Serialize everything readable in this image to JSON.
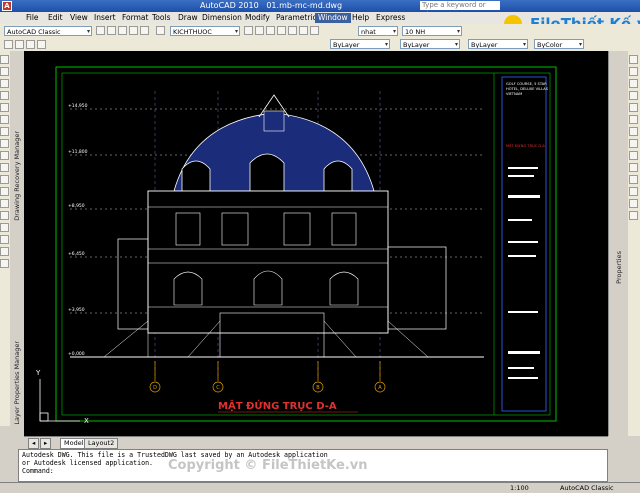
{
  "titlebar": {
    "app_title": "AutoCAD 2010",
    "file_name": "01.mb-mc-md.dwg",
    "search_placeholder": "Type a keyword or phrase"
  },
  "menu": [
    "File",
    "Edit",
    "View",
    "Insert",
    "Format",
    "Tools",
    "Draw",
    "Dimension",
    "Modify",
    "Parametric",
    "Window",
    "Help",
    "Express"
  ],
  "menu_active": "Window",
  "toolbar": {
    "workspace": "AutoCAD Classic",
    "dimstyle": "KICHTHUOC",
    "layer": "nhat",
    "color": "ByLayer",
    "linetype": "ByLayer",
    "lineweight": "10 NH",
    "linetype2": "ByLayer",
    "plotstyle": "ByColor"
  },
  "left_panels": [
    "Drawing Recovery Manager",
    "Layer Properties Manager"
  ],
  "right_panels": [
    "Properties"
  ],
  "drawing": {
    "elevation_title": "MẶT ĐỨNG TRỤC D-A",
    "axis_labels": [
      "D",
      "C",
      "B",
      "A"
    ],
    "title_block_text": [
      "GOLF COURSE, 5 STAR",
      "HOTEL, DELUXE VILLAS",
      "VIETNAM",
      "MẶT ĐỨNG TRỤC D-A"
    ],
    "level_marks": [
      "+14,950",
      "+11,800",
      "+8,950",
      "+6,450",
      "+3,950",
      "+0,000"
    ],
    "ucs_x": "X",
    "ucs_y": "Y"
  },
  "tabs": [
    "Model",
    "Layout2"
  ],
  "command_lines": [
    "Autodesk DWG.  This file is a TrustedDWG last saved by an Autodesk application",
    "or Autodesk licensed application.",
    "Command:"
  ],
  "status": {
    "scale": "1:100",
    "workspace": "AutoCAD Classic"
  },
  "watermark": "Copyright © FileThietKe.vn",
  "brand": {
    "name": "FileThiết Kế.vn"
  },
  "colors": {
    "drawing_bg": "#000000",
    "title_red": "#e03030",
    "accent": "#1f7fd0"
  }
}
